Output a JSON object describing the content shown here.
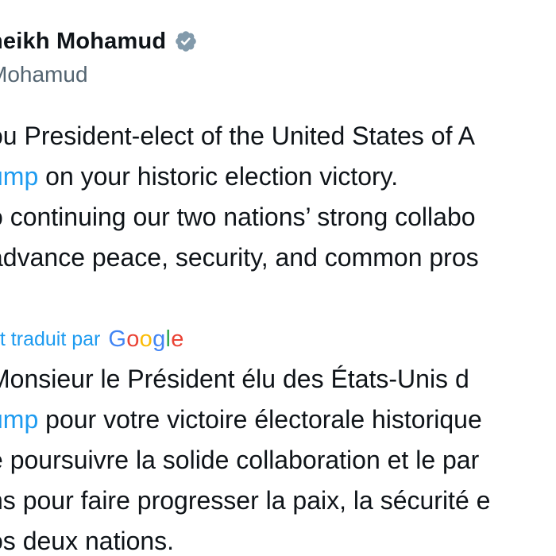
{
  "author": {
    "display_name": "heikh Mohamud",
    "handle": "Mohamud",
    "verified_icon": "verified-badge-icon",
    "verified_color": "#829aab"
  },
  "tweet": {
    "original_lines": [
      {
        "text": "ou President-elect of the United States of A"
      },
      {
        "mention": "ump",
        "text": " on your historic election victory."
      },
      {
        "text": "o continuing our two nations’ strong collabo"
      },
      {
        "text": "advance peace, security, and common pros"
      }
    ],
    "translation_label": "et traduit par",
    "translation_logo": [
      "G",
      "o",
      "o",
      "g",
      "l",
      "e"
    ],
    "translated_lines": [
      {
        "text": "Monsieur le Président élu des États-Unis d"
      },
      {
        "mention": "ump",
        "text": " pour votre victoire électorale historique"
      },
      {
        "text": "e poursuivre la solide collaboration et le par"
      },
      {
        "text": "ns pour faire progresser la paix, la sécurité e"
      },
      {
        "text": "os deux nations."
      }
    ]
  },
  "colors": {
    "text": "#0f1419",
    "secondary": "#536471",
    "link": "#1d9bf0"
  }
}
